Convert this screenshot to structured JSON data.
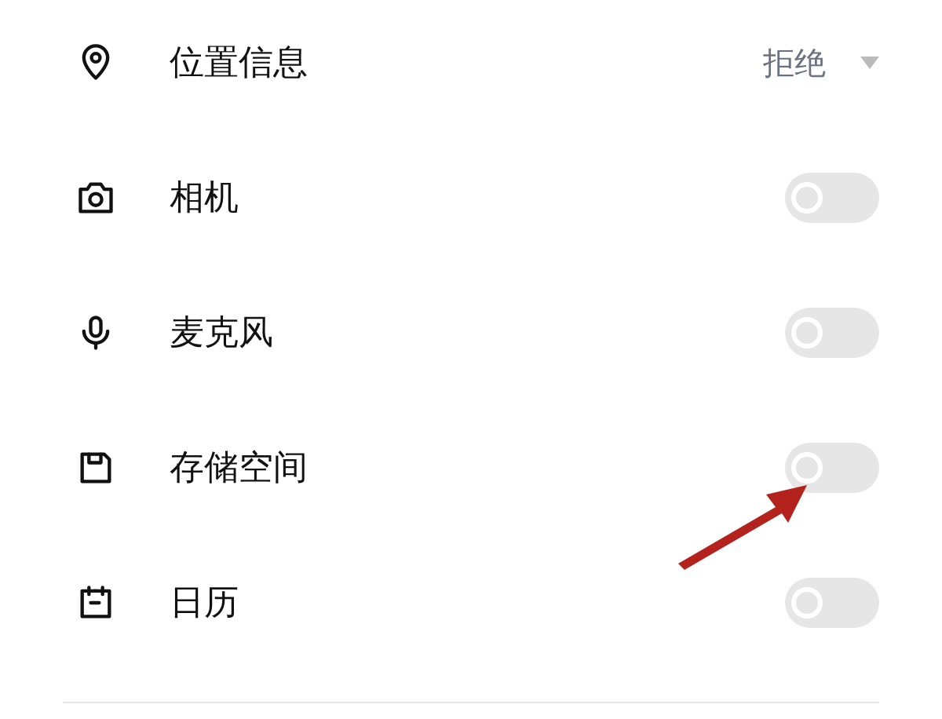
{
  "permissions": [
    {
      "kind": "dropdown",
      "label": "位置信息",
      "value": "拒绝"
    },
    {
      "kind": "toggle",
      "label": "相机",
      "on": false
    },
    {
      "kind": "toggle",
      "label": "麦克风",
      "on": false
    },
    {
      "kind": "toggle",
      "label": "存储空间",
      "on": false
    },
    {
      "kind": "toggle",
      "label": "日历",
      "on": false
    }
  ]
}
